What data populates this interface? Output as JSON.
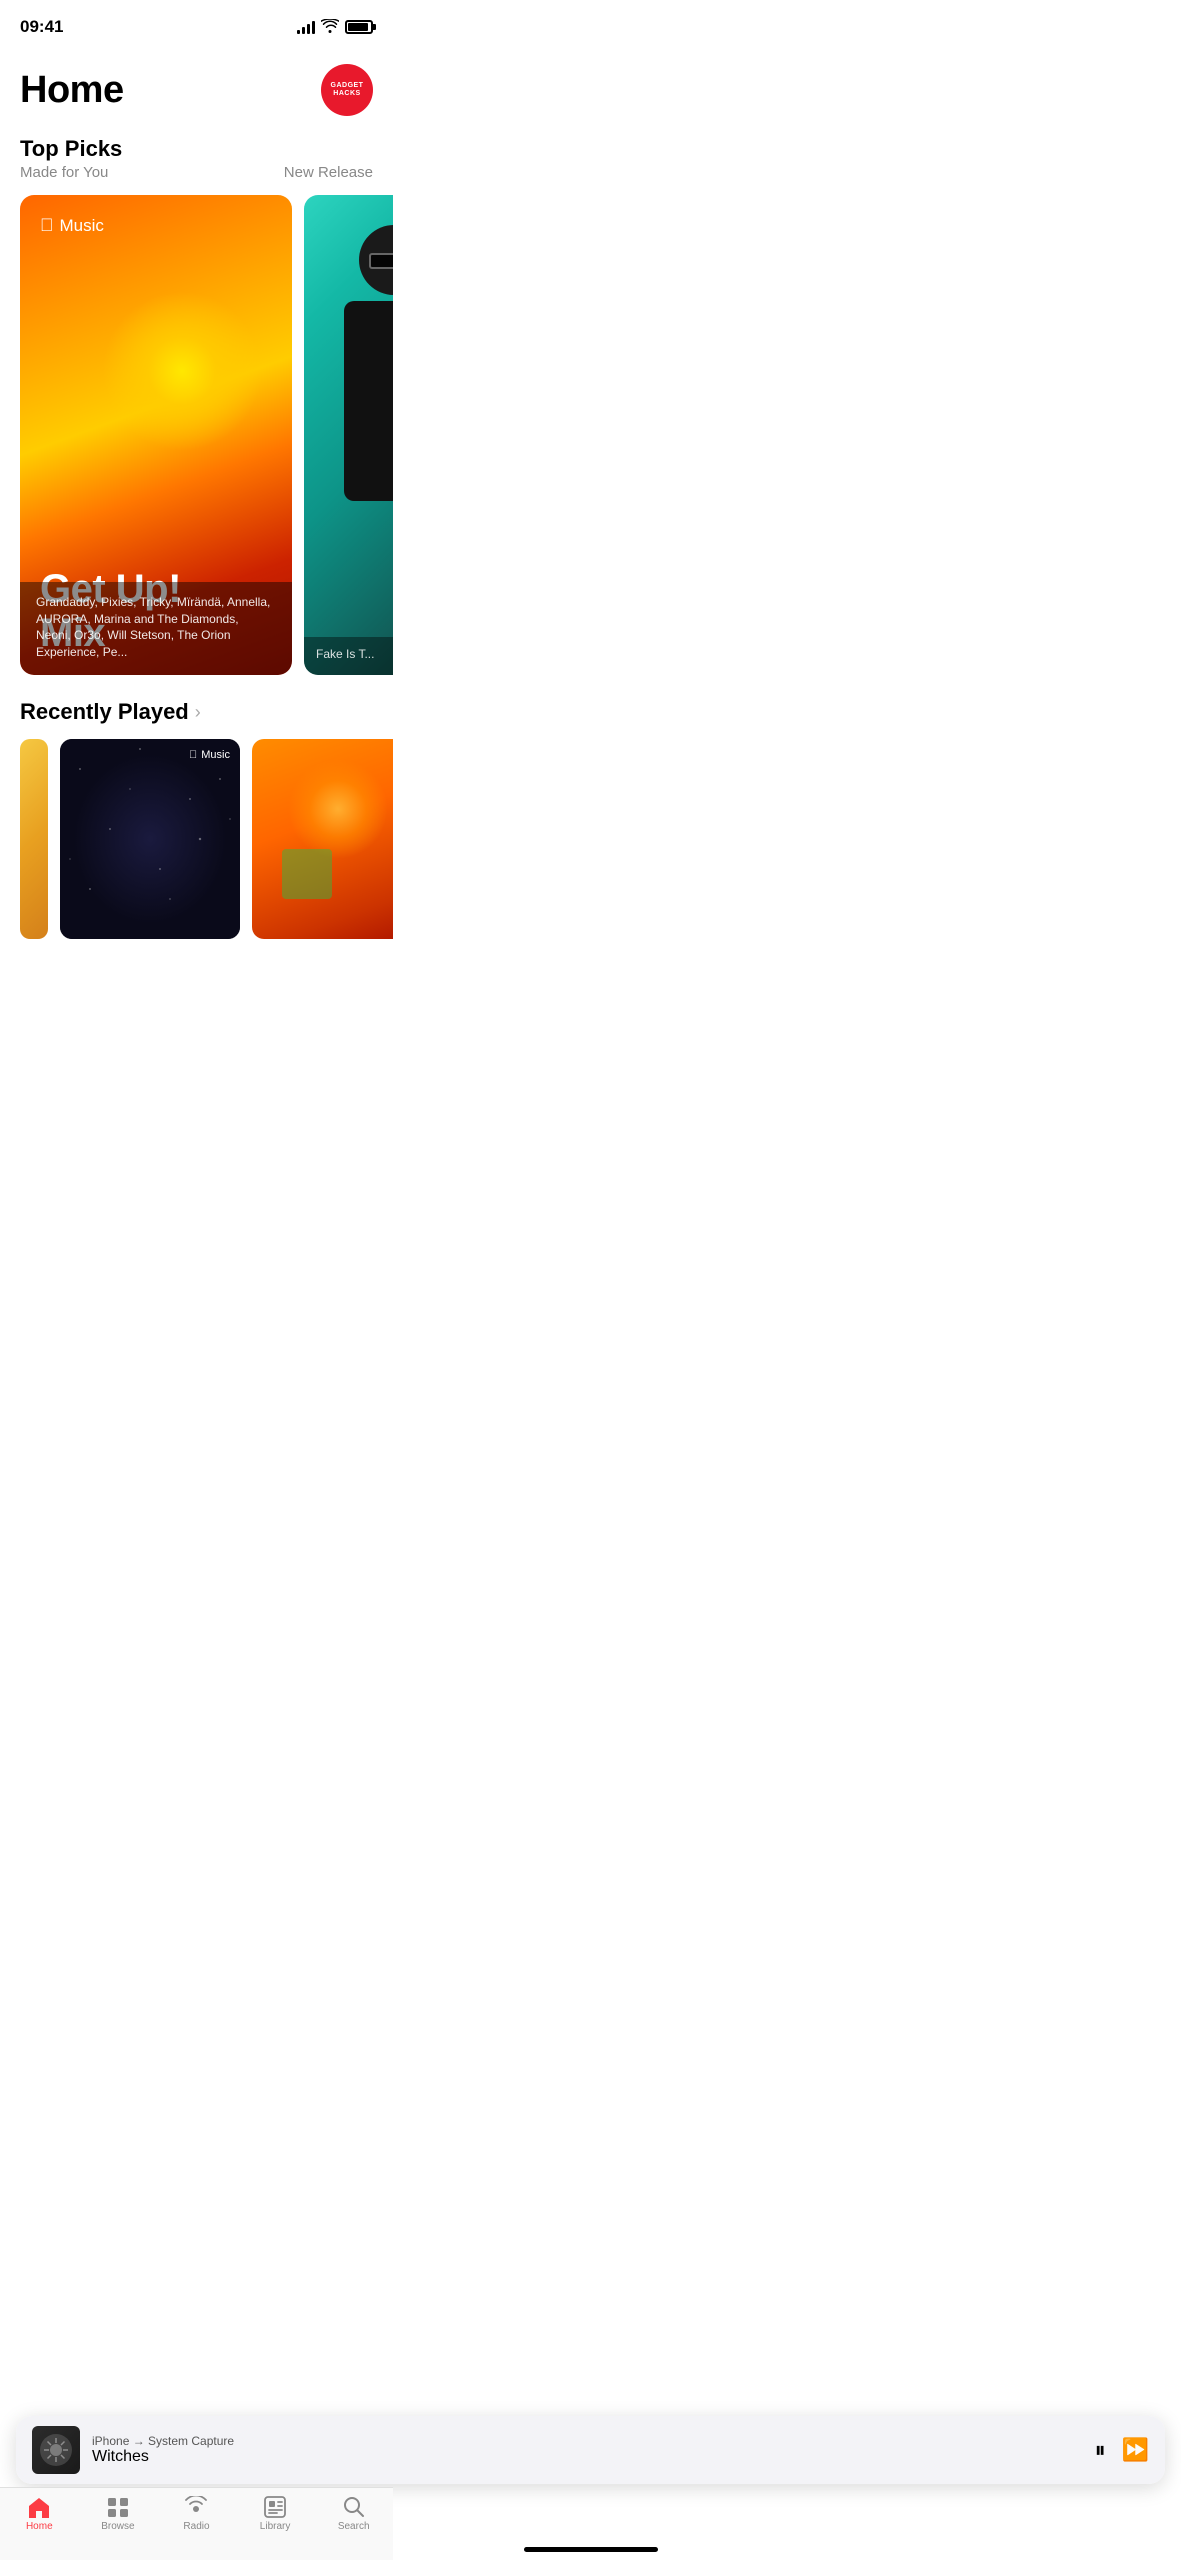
{
  "statusBar": {
    "time": "09:41"
  },
  "header": {
    "title": "Home",
    "badge": {
      "line1": "GADGET",
      "line2": "HACKS"
    }
  },
  "topPicks": {
    "sectionTitle": "Top Picks",
    "leftSubtitle": "Made for You",
    "rightLink": "New Release",
    "mainCard": {
      "brandLabel": "Music",
      "title": "Get Up!",
      "subtitle": "Mix",
      "description": "Grandaddy, Pixies, Tricky, Mïrändä, Annella, AURORA, Marina and The Diamonds, Neoni, Or3o, Will Stetson, The Orion Experience, Pe..."
    },
    "secondCard": {
      "label": "Fake Is T..."
    }
  },
  "recentlyPlayed": {
    "title": "Recently Played",
    "chevron": "›"
  },
  "miniPlayer": {
    "device": "iPhone → System Capture",
    "song": "Witches"
  },
  "tabBar": {
    "tabs": [
      {
        "id": "home",
        "label": "Home",
        "active": true
      },
      {
        "id": "browse",
        "label": "Browse",
        "active": false
      },
      {
        "id": "radio",
        "label": "Radio",
        "active": false
      },
      {
        "id": "library",
        "label": "Library",
        "active": false
      },
      {
        "id": "search",
        "label": "Search",
        "active": false
      }
    ]
  }
}
